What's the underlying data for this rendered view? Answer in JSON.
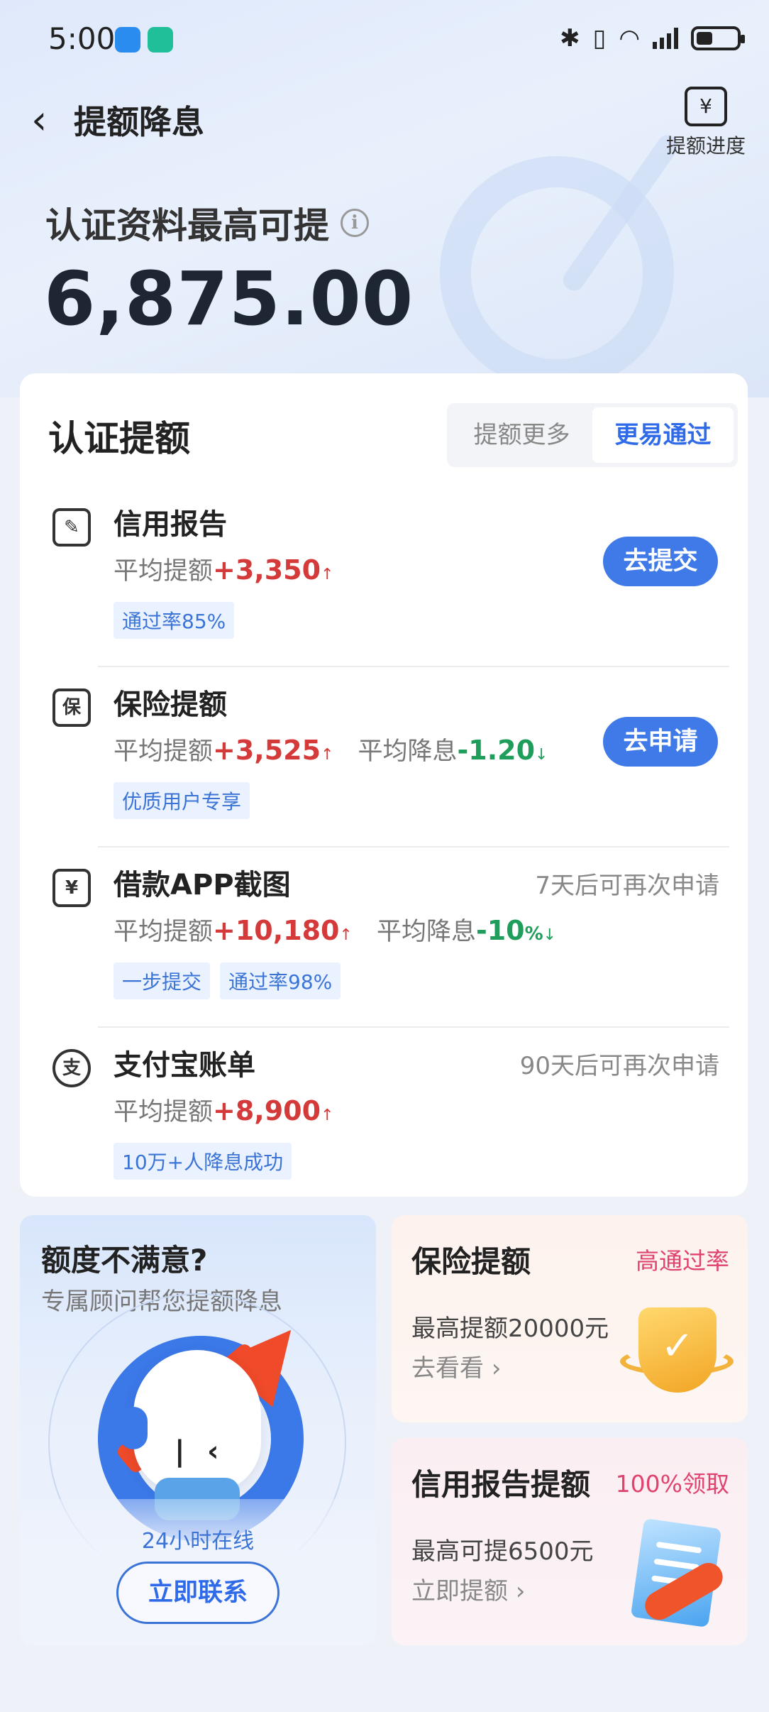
{
  "status_bar": {
    "time": "5:00"
  },
  "nav": {
    "back_icon": "chevron-left-icon",
    "title": "提额降息",
    "progress_label": "提额进度"
  },
  "hero": {
    "label": "认证资料最高可提",
    "amount": "6,875.00"
  },
  "section": {
    "title": "认证提额",
    "tabs": [
      {
        "label": "提额更多",
        "active": false
      },
      {
        "label": "更易通过",
        "active": true
      }
    ]
  },
  "items": [
    {
      "title": "信用报告",
      "avg_label": "平均提额",
      "avg_value": "+3,350",
      "tags": [
        "通过率85%"
      ],
      "button": "去提交"
    },
    {
      "title": "保险提额",
      "avg_label": "平均提额",
      "avg_value": "+3,525",
      "rate_label": "平均降息",
      "rate_value": "-1.20",
      "tags": [
        "优质用户专享"
      ],
      "button": "去申请"
    },
    {
      "title": "借款APP截图",
      "avg_label": "平均提额",
      "avg_value": "+10,180",
      "rate_label": "平均降息",
      "rate_value": "-10",
      "rate_unit": "%",
      "tags": [
        "一步提交",
        "通过率98%"
      ],
      "retry": "7天后可再次申请"
    },
    {
      "title": "支付宝账单",
      "avg_label": "平均提额",
      "avg_value": "+8,900",
      "tags": [
        "10万+人降息成功"
      ],
      "retry": "90天后可再次申请"
    }
  ],
  "advisor": {
    "title": "额度不满意?",
    "subtitle": "专属顾问帮您提额降息",
    "online": "24小时在线",
    "button": "立即联系"
  },
  "promos": [
    {
      "title": "保险提额",
      "badge": "高通过率",
      "line": "最高提额20000元",
      "link": "去看看"
    },
    {
      "title": "信用报告提额",
      "badge": "100%领取",
      "line": "最高可提6500元",
      "link": "立即提额"
    }
  ],
  "colors": {
    "accent": "#3f7ae8",
    "up": "#d43a3a",
    "down": "#1f9d5a",
    "badge": "#e0436d"
  }
}
